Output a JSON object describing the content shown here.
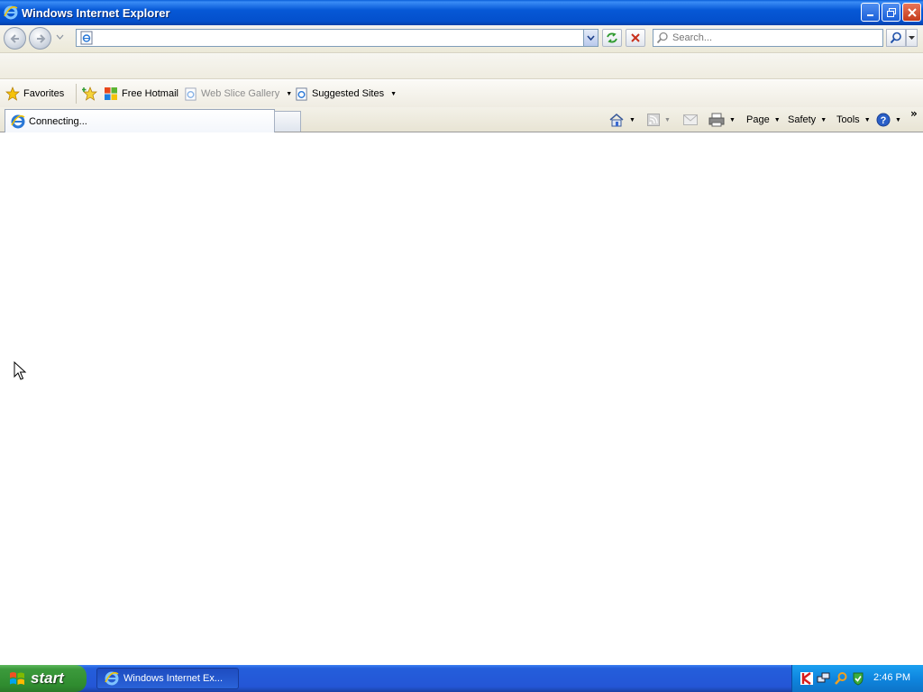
{
  "window": {
    "title": "Windows Internet Explorer",
    "icon": "ie-logo-icon"
  },
  "nav": {
    "address_value": "",
    "search_placeholder": "Search..."
  },
  "favorites_bar": {
    "label": "Favorites",
    "items": [
      {
        "label": "Free Hotmail",
        "icon": "windows-logo-icon",
        "enabled": true
      },
      {
        "label": "Web Slice Gallery",
        "icon": "ie-page-icon",
        "enabled": false
      },
      {
        "label": "Suggested Sites",
        "icon": "ie-page-icon",
        "enabled": true
      }
    ]
  },
  "tab": {
    "label": "Connecting..."
  },
  "command_bar": {
    "page_label": "Page",
    "safety_label": "Safety",
    "tools_label": "Tools"
  },
  "taskbar": {
    "start_label": "start",
    "task_label": "Windows Internet Ex...",
    "clock": "2:46 PM"
  }
}
